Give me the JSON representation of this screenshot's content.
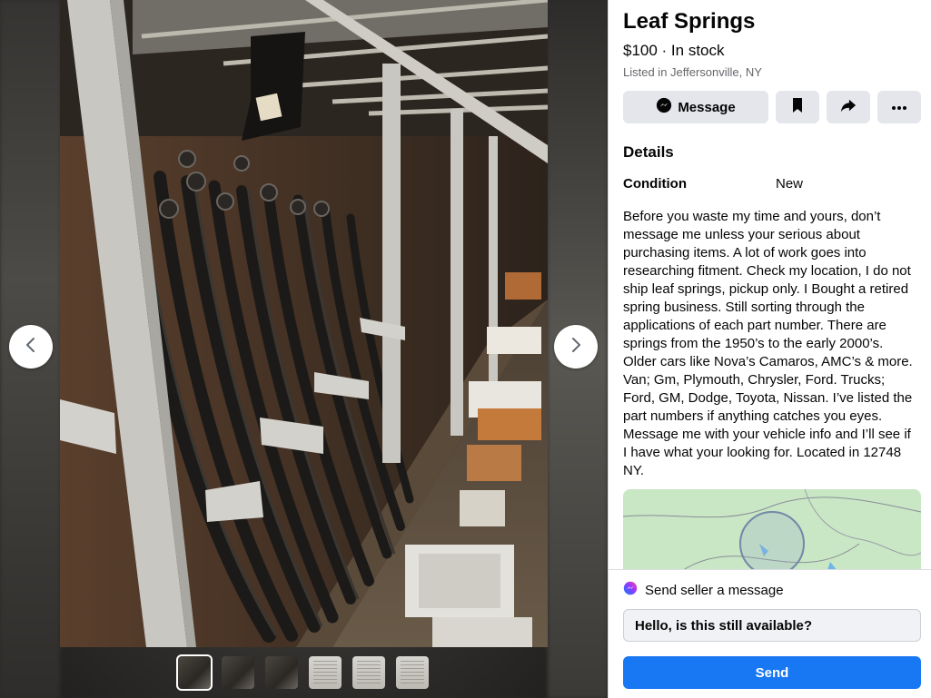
{
  "listing": {
    "title": "Leaf Springs",
    "price": "$100 · In stock",
    "location": "Listed in Jeffersonville, NY"
  },
  "actions": {
    "message_label": "Message",
    "save_icon": "bookmark-icon",
    "share_icon": "share-icon",
    "more_icon": "more-icon"
  },
  "details": {
    "heading": "Details",
    "condition_label": "Condition",
    "condition_value": "New",
    "description": "Before you waste my time and yours, don’t message me unless your serious about purchasing items. A lot of work goes into researching fitment. Check my location, I do not ship leaf springs, pickup only. I Bought a retired spring business. Still sorting through the applications of each part number. There are springs from the 1950’s to the early 2000’s. Older cars like Nova’s Camaros, AMC’s & more. Van; Gm, Plymouth, Chrysler, Ford. Trucks; Ford, GM, Dodge, Toyota, Nissan. I’ve listed the part numbers if anything catches you eyes. Message me with your vehicle info and I’ll see if I have what your looking for. Located in 12748 NY."
  },
  "viewer": {
    "prev_icon": "chevron-left-icon",
    "next_icon": "chevron-right-icon",
    "thumbnail_count": 6,
    "active_thumbnail": 1
  },
  "composer": {
    "heading": "Send seller a message",
    "input_value": "Hello, is this still available?",
    "send_label": "Send"
  },
  "colors": {
    "accent": "#1877f2",
    "button_bg": "#e4e6eb",
    "secondary_text": "#65676b"
  }
}
